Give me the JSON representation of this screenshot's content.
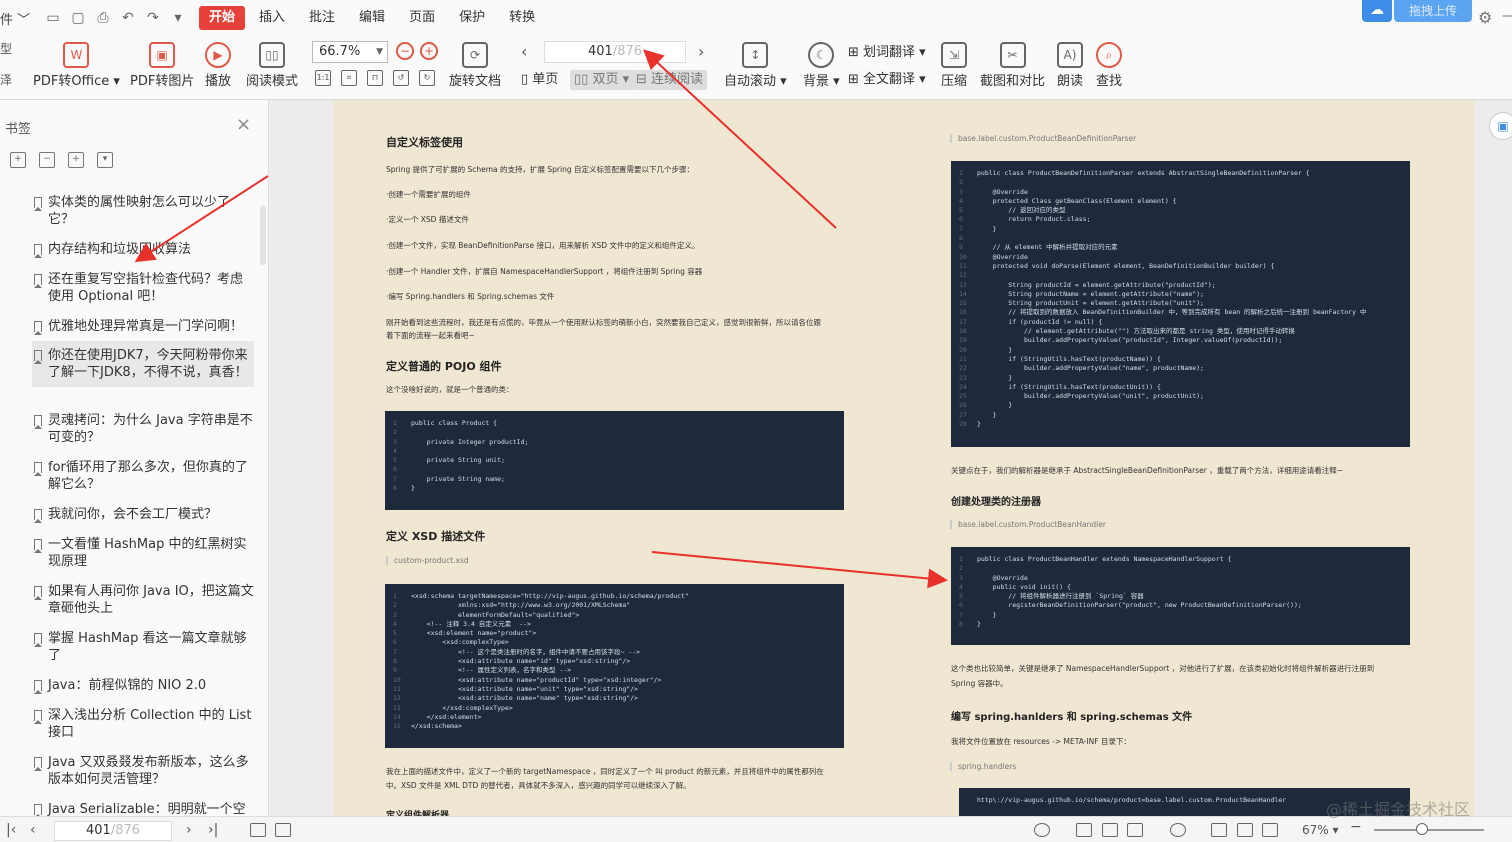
{
  "app": {
    "left_cut": "件",
    "menus": [
      "开始",
      "插入",
      "批注",
      "编辑",
      "页面",
      "保护",
      "转换"
    ],
    "upload": "拖拽上传"
  },
  "toolbar": {
    "pdf_office": "PDF转Office",
    "pdf_image": "PDF转图片",
    "play": "播放",
    "read_mode": "阅读模式",
    "zoom": "66.7%",
    "rotate": "旋转文档",
    "page_current": "401",
    "page_total": "/876",
    "single": "单页",
    "double": "双页",
    "continuous": "连续阅读",
    "auto_scroll": "自动滚动",
    "background": "背景",
    "word_translate": "划词翻译",
    "full_translate": "全文翻译",
    "compress": "压缩",
    "screenshot": "截图和对比",
    "read_aloud": "朗读",
    "find": "查找"
  },
  "sidebar": {
    "title": "书签",
    "bookmarks": [
      "实体类的属性映射怎么可以少了它？",
      "内存结构和垃圾回收算法",
      "还在重复写空指针检查代码？考虑使用 Optional 吧！",
      "优雅地处理异常真是一门学问啊！",
      "你还在使用JDK7，今天阿粉带你来了解一下JDK8，不得不说，真香！",
      "灵魂拷问：为什么 Java 字符串是不可变的？",
      "for循环用了那么多次，但你真的了解它么？",
      "我就问你，会不会工厂模式？",
      "一文看懂 HashMap 中的红黑树实现原理",
      "如果有人再问你 Java IO，把这篇文章砸他头上",
      "掌握 HashMap 看这一篇文章就够了",
      "Java：前程似锦的 NIO 2.0",
      "深入浅出分析 Collection 中的 List 接口",
      "Java 又双叒叕发布新版本，这么多版本如何灵活管理？",
      "Java Serializable：明明就一个空"
    ]
  },
  "docL": {
    "h1": "自定义标签使用",
    "p1": "Spring 提供了可扩展的 Schema 的支持，扩展 Spring 自定义标签配置需要以下几个步骤：",
    "steps": [
      "·创建一个需要扩展的组件",
      "·定义一个 XSD 描述文件",
      "·创建一个文件，实现 BeanDefinitionParse 接口，用来解析 XSD 文件中的定义和组件定义。",
      "·创建一个 Handler 文件，扩展自 NamespaceHandlerSupport ，将组件注册到 Spring 容器",
      "·编写 Spring.handlers 和 Spring.schemas 文件"
    ],
    "p2": "刚开始看到这些流程时，我还是有点慌的，毕竟从一个使用默认标签的萌新小白，突然要我自己定义，感觉到很新鲜，所以请各位跟",
    "p3": "着下面的流程一起来看吧~",
    "h2": "定义普通的 POJO 组件",
    "p4": "这个没啥好说的，就是一个普通的类：",
    "code1": "public class Product {\n\n    private Integer productId;\n\n    private String unit;\n\n    private String name;\n}",
    "h3": "定义 XSD 描述文件",
    "cap1": "custom-product.xsd",
    "code2": "<xsd:schema targetNamespace=\"http://vip-augus.github.io/schema/product\"\n            xmlns:xsd=\"http://www.w3.org/2001/XMLSchema\"\n            elementFormDefault=\"qualified\">\n    <!-- 注释 3.4 自定义元素  -->\n    <xsd:element name=\"product\">\n        <xsd:complexType>\n            <!-- 这个是类注册时的名字，组件中请不要占用该字段~ -->\n            <xsd:attribute name=\"id\" type=\"xsd:string\"/>\n            <!-- 属性定义列表，名字和类型 -->\n            <xsd:attribute name=\"productId\" type=\"xsd:integer\"/>\n            <xsd:attribute name=\"unit\" type=\"xsd:string\"/>\n            <xsd:attribute name=\"name\" type=\"xsd:string\"/>\n        </xsd:complexType>\n    </xsd:element>\n</xsd:schema>",
    "p5": "我在上面的描述文件中，定义了一个新的 targetNamespace ，同时定义了一个 叫 product 的新元素，并且将组件中的属性都列在",
    "p6": "中。XSD 文件是 XML DTD 的替代者，具体就不多深入，感兴趣的同学可以继续深入了解。",
    "h4": "定义组件解析器"
  },
  "docR": {
    "cap1": "base.label.custom.ProductBeanDefinitionParser",
    "code1": "public class ProductBeanDefinitionParser extends AbstractSingleBeanDefinitionParser {\n\n    @Override\n    protected Class getBeanClass(Element element) {\n        // 返回对应的类型\n        return Product.class;\n    }\n\n    // 从 element 中解析并提取对应的元素\n    @Override\n    protected void doParse(Element element, BeanDefinitionBuilder builder) {\n\n        String productId = element.getAttribute(\"productId\");\n        String productName = element.getAttribute(\"name\");\n        String productUnit = element.getAttribute(\"unit\");\n        // 将提取到的数据放入 BeanDefinitionBuilder 中，等到完成所有 bean 的解析之后统一注册到 beanFactory 中\n        if (productId != null) {\n            // element.getAttribute(\"\") 方法取出来的都是 string 类型，使用时记得手动转换\n            builder.addPropertyValue(\"productId\", Integer.valueOf(productId));\n        }\n        if (StringUtils.hasText(productName)) {\n            builder.addPropertyValue(\"name\", productName);\n        }\n        if (StringUtils.hasText(productUnit)) {\n            builder.addPropertyValue(\"unit\", productUnit);\n        }\n    }\n}",
    "p1": "关键点在于，我们的解析器是继承于 AbstractSingleBeanDefinitionParser ，重载了两个方法，详细用途请看注释~",
    "h1": "创建处理类的注册器",
    "cap2": "base.label.custom.ProductBeanHandler",
    "code2": "public class ProductBeanHandler extends NamespaceHandlerSupport {\n\n    @Override\n    public void init() {\n        // 将组件解析器进行注册到 `Spring` 容器\n        registerBeanDefinitionParser(\"product\", new ProductBeanDefinitionParser());\n    }\n}",
    "p2": "这个类也比较简单，关键是继承了 NamespaceHandlerSupport ，对他进行了扩展，在该类初始化时将组件解析器进行注册到",
    "p3": "Spring 容器中。",
    "h2": "编写 spring.hanlders 和 spring.schemas 文件",
    "p4": "我将文件位置放在 resources -> META-INF 目录下：",
    "cap3": "spring.handlers",
    "code3": "http\\://vip-augus.github.io/schema/product=base.label.custom.ProductBeanHandler"
  },
  "status": {
    "page_current": "401",
    "page_total": "/876",
    "zoom": "67%"
  },
  "watermark": "@稀土掘金技术社区"
}
